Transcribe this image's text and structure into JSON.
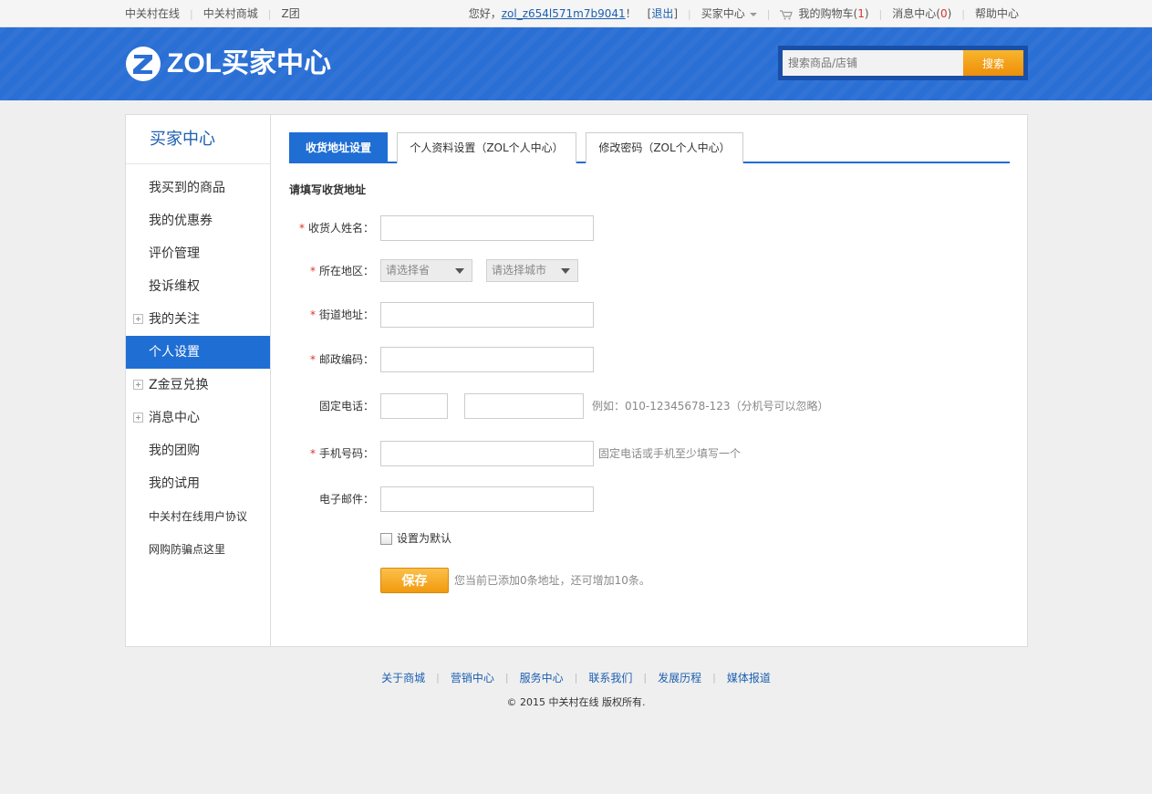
{
  "topbar": {
    "left_links": [
      "中关村在线",
      "中关村商城",
      "Z团"
    ],
    "greeting": "您好，",
    "username": "zol_z654l571m7b9041",
    "greeting_end": "！",
    "logout_open": "[",
    "logout": "退出",
    "logout_close": "]",
    "buyer_center": "买家中心",
    "cart_label": "我的购物车",
    "cart_count": "1",
    "msg_label": "消息中心",
    "msg_count": "0",
    "help": "帮助中心",
    "paren_open": "(",
    "paren_close": ")"
  },
  "header": {
    "logo_text": "ZOL买家中心",
    "search_placeholder": "搜索商品/店铺",
    "search_button": "搜索"
  },
  "sidebar": {
    "title": "买家中心",
    "items": [
      {
        "label": "我买到的商品",
        "expandable": false,
        "active": false
      },
      {
        "label": "我的优惠券",
        "expandable": false,
        "active": false
      },
      {
        "label": "评价管理",
        "expandable": false,
        "active": false
      },
      {
        "label": "投诉维权",
        "expandable": false,
        "active": false
      },
      {
        "label": "我的关注",
        "expandable": true,
        "active": false
      },
      {
        "label": "个人设置",
        "expandable": false,
        "active": true
      },
      {
        "label": "Z金豆兑换",
        "expandable": true,
        "active": false
      },
      {
        "label": "消息中心",
        "expandable": true,
        "active": false
      },
      {
        "label": "我的团购",
        "expandable": false,
        "active": false
      },
      {
        "label": "我的试用",
        "expandable": false,
        "active": false
      },
      {
        "label": "中关村在线用户协议",
        "expandable": false,
        "active": false
      },
      {
        "label": "网购防骗点这里",
        "expandable": false,
        "active": false
      }
    ]
  },
  "tabs": [
    {
      "label": "收货地址设置",
      "active": true
    },
    {
      "label": "个人资料设置（ZOL个人中心）",
      "active": false
    },
    {
      "label": "修改密码（ZOL个人中心）",
      "active": false
    }
  ],
  "form": {
    "section_title": "请填写收货地址",
    "required_mark": "*",
    "name_label": "收货人姓名：",
    "region_label": "所在地区：",
    "province_placeholder": "请选择省",
    "city_placeholder": "请选择城市",
    "street_label": "街道地址：",
    "zip_label": "邮政编码：",
    "phone_label": "固定电话：",
    "phone_hint": "例如：010-12345678-123（分机号可以忽略）",
    "mobile_label": "手机号码：",
    "mobile_hint": "固定电话或手机至少填写一个",
    "email_label": "电子邮件：",
    "default_label": "设置为默认",
    "save_button": "保存",
    "save_hint": "您当前已添加0条地址，还可增加10条。"
  },
  "footer": {
    "links": [
      "关于商城",
      "营销中心",
      "服务中心",
      "联系我们",
      "发展历程",
      "媒体报道"
    ],
    "copyright": "© 2015 中关村在线 版权所有."
  }
}
